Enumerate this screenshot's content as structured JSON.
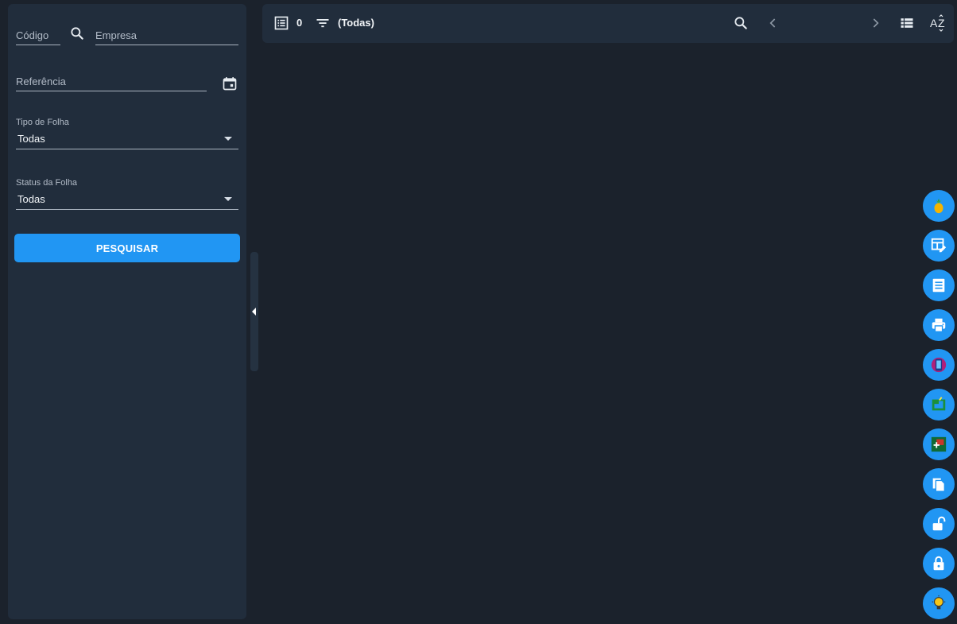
{
  "filters": {
    "codigo_placeholder": "Código",
    "empresa_placeholder": "Empresa",
    "referencia_placeholder": "Referência",
    "tipo_folha": {
      "label": "Tipo de Folha",
      "value": "Todas"
    },
    "status_folha": {
      "label": "Status da Folha",
      "value": "Todas"
    },
    "search_button_label": "PESQUISAR"
  },
  "toolbar": {
    "record_count": "0",
    "filter_text": "(Todas)"
  },
  "icons": {
    "list": "list-icon",
    "filter": "filter-icon",
    "search": "search-icon",
    "prev": "chevron-left-icon",
    "next": "chevron-right-icon",
    "view": "view-list-icon",
    "sort": "sort-az-icon",
    "calendar": "calendar-icon"
  },
  "fab_actions": [
    "pineapple-icon",
    "table-edit-icon",
    "receipt-icon",
    "print-icon",
    "device-icon",
    "import-icon",
    "add-window-icon",
    "copy-icon",
    "unlock-icon",
    "lock-icon",
    "lightbulb-icon"
  ],
  "colors": {
    "background": "#1b222c",
    "panel": "#212d3c",
    "accent": "#2196f3"
  }
}
